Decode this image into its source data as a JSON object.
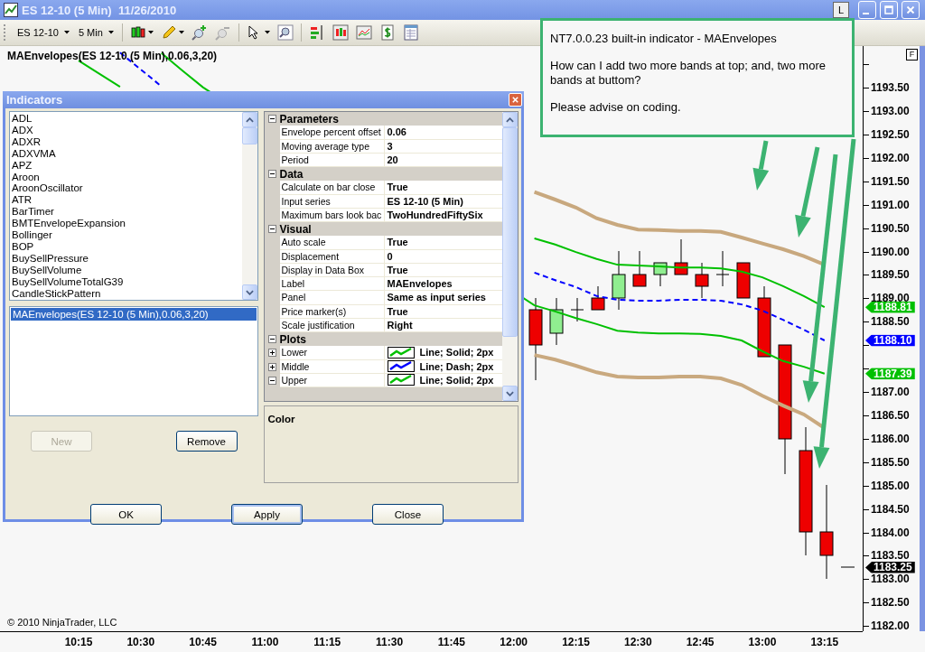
{
  "window": {
    "title": "ES 12-10 (5 Min)  11/26/2010",
    "extra_button": "L"
  },
  "toolbar": {
    "instrument": "ES 12-10",
    "interval": "5 Min"
  },
  "chart": {
    "label": "MAEnvelopes(ES 12-10 (5 Min),0.06,3,20)",
    "copyright": "© 2010 NinjaTrader, LLC",
    "scale_button": "F",
    "chart_data": {
      "type": "line",
      "xlim": [
        596.04,
        804.2
      ],
      "ylim": [
        1181.85,
        1194.39
      ],
      "x": [
        615,
        620,
        625,
        630,
        635,
        640,
        645,
        725,
        730,
        735,
        740,
        745,
        750,
        755,
        760,
        765,
        770,
        775,
        780,
        785,
        790,
        795
      ],
      "series": [
        {
          "color": "#c8a87e",
          "values": [
            null,
            null,
            null,
            null,
            null,
            null,
            null,
            1191.27,
            1191.11,
            1190.94,
            1190.71,
            1190.57,
            1190.47,
            1190.46,
            1190.44,
            1190.44,
            1190.42,
            1190.3,
            1190.17,
            1190.05,
            1189.9,
            1189.72
          ]
        },
        {
          "color": "#c9a97f",
          "values": [
            null,
            null,
            null,
            null,
            null,
            null,
            null,
            1187.79,
            1187.69,
            1187.56,
            1187.42,
            1187.33,
            1187.31,
            1187.31,
            1187.33,
            1187.33,
            1187.29,
            1187.15,
            1186.92,
            1186.71,
            1186.52,
            1186.23
          ]
        },
        {
          "color": "#00c000",
          "values": [
            1194.08,
            1193.8,
            1193.52,
            null,
            null,
            null,
            null,
            1190.28,
            1190.15,
            1189.99,
            1189.84,
            1189.72,
            1189.7,
            1189.68,
            1189.66,
            1189.66,
            1189.64,
            1189.57,
            1189.45,
            1189.26,
            1189.05,
            1188.81
          ]
        },
        {
          "color": "#0000ff",
          "line_style": "dashed",
          "values": [
            null,
            null,
            1194.25,
            1193.89,
            1193.53,
            null,
            null,
            1189.55,
            1189.39,
            1189.24,
            1189.05,
            1188.97,
            1188.95,
            1188.95,
            1188.97,
            1188.97,
            1188.95,
            1188.87,
            1188.74,
            1188.54,
            1188.33,
            1188.1
          ]
        },
        {
          "color": "#00c001",
          "values": [
            null,
            null,
            null,
            null,
            1194.24,
            1193.87,
            1193.51,
            1188.85,
            1188.72,
            1188.58,
            1188.45,
            1188.31,
            1188.27,
            1188.25,
            1188.25,
            1188.24,
            1188.2,
            1188.1,
            1187.87,
            1187.66,
            1187.54,
            1187.39
          ]
        }
      ],
      "yticks": [
        {
          "value": 1182,
          "label": "1182.00"
        },
        {
          "value": 1182.5,
          "label": "1182.50"
        },
        {
          "value": 1183,
          "label": "1183.00"
        },
        {
          "value": 1183.5,
          "label": "1183.50"
        },
        {
          "value": 1184,
          "label": "1184.00"
        },
        {
          "value": 1184.5,
          "label": "1184.50"
        },
        {
          "value": 1185,
          "label": "1185.00"
        },
        {
          "value": 1185.5,
          "label": "1185.50"
        },
        {
          "value": 1186,
          "label": "1186.00"
        },
        {
          "value": 1186.5,
          "label": "1186.50"
        },
        {
          "value": 1187,
          "label": "1187.00"
        },
        {
          "value": 1188.5,
          "label": "1188.50"
        },
        {
          "value": 1189,
          "label": "1189.00"
        },
        {
          "value": 1189.5,
          "label": "1189.50"
        },
        {
          "value": 1190,
          "label": "1190.00"
        },
        {
          "value": 1190.5,
          "label": "1190.50"
        },
        {
          "value": 1191,
          "label": "1191.00"
        },
        {
          "value": 1191.5,
          "label": "1191.50"
        },
        {
          "value": 1192,
          "label": "1192.00"
        },
        {
          "value": 1192.5,
          "label": "1192.50"
        },
        {
          "value": 1193,
          "label": "1193.00"
        },
        {
          "value": 1193.5,
          "label": "1193.50"
        }
      ],
      "xticks": [
        {
          "value": 615,
          "label": "10:15"
        },
        {
          "value": 630,
          "label": "10:30"
        },
        {
          "value": 645,
          "label": "10:45"
        },
        {
          "value": 660,
          "label": "11:00"
        },
        {
          "value": 675,
          "label": "11:15"
        },
        {
          "value": 690,
          "label": "11:30"
        },
        {
          "value": 705,
          "label": "11:45"
        },
        {
          "value": 720,
          "label": "12:00"
        },
        {
          "value": 735,
          "label": "12:15"
        },
        {
          "value": 750,
          "label": "12:30"
        },
        {
          "value": 765,
          "label": "12:45"
        },
        {
          "value": 780,
          "label": "13:00"
        },
        {
          "value": 795,
          "label": "13:15"
        }
      ]
    },
    "price_markers": [
      {
        "text": "1188.81",
        "color": "#00c000"
      },
      {
        "text": "1188.10",
        "color": "#0000ff"
      },
      {
        "text": "1187.39",
        "color": "#00c000"
      },
      {
        "text": "1183.25",
        "color": "#000000"
      }
    ]
  },
  "annotation": {
    "paragraphs": [
      "NT7.0.0.23 built-in indicator - MAEnvelopes",
      "How can I add two more bands at top; and, two more bands at buttom?",
      "Please advise on coding."
    ]
  },
  "dialog": {
    "title": "Indicators",
    "available": [
      {
        "label": "ADL",
        "selected": false
      },
      {
        "label": "ADX",
        "selected": false
      },
      {
        "label": "ADXR",
        "selected": false
      },
      {
        "label": "ADXVMA",
        "selected": false
      },
      {
        "label": "APZ",
        "selected": false
      },
      {
        "label": "Aroon",
        "selected": false
      },
      {
        "label": "AroonOscillator",
        "selected": false
      },
      {
        "label": "ATR",
        "selected": false
      },
      {
        "label": "BarTimer",
        "selected": false
      },
      {
        "label": "BMTEnvelopeExpansion",
        "selected": false
      },
      {
        "label": "Bollinger",
        "selected": false
      },
      {
        "label": "BOP",
        "selected": false
      },
      {
        "label": "BuySellPressure",
        "selected": false
      },
      {
        "label": "BuySellVolume",
        "selected": false
      },
      {
        "label": "BuySellVolumeTotalG39",
        "selected": false
      },
      {
        "label": "CandleStickPattern",
        "selected": false
      }
    ],
    "configured": [
      {
        "label": "MAEnvelopes(ES 12-10 (5 Min),0.06,3,20)",
        "selected": true
      }
    ],
    "list_buttons": [
      {
        "label": "New",
        "disabled": true
      },
      {
        "label": "Remove",
        "disabled": false
      }
    ],
    "properties": [
      {
        "category": "Parameters",
        "expanded": true,
        "rows": [
          {
            "name": "Envelope percent offset",
            "value": "0.06"
          },
          {
            "name": "Moving average type",
            "value": "3"
          },
          {
            "name": "Period",
            "value": "20"
          }
        ]
      },
      {
        "category": "Data",
        "expanded": true,
        "rows": [
          {
            "name": "Calculate on bar close",
            "value": "True"
          },
          {
            "name": "Input series",
            "value": "ES 12-10 (5 Min)"
          },
          {
            "name": "Maximum bars look bac",
            "value": "TwoHundredFiftySix"
          }
        ]
      },
      {
        "category": "Visual",
        "expanded": true,
        "rows": [
          {
            "name": "Auto scale",
            "value": "True"
          },
          {
            "name": "Displacement",
            "value": "0"
          },
          {
            "name": "Display in Data Box",
            "value": "True"
          },
          {
            "name": "Label",
            "value": "MAEnvelopes"
          },
          {
            "name": "Panel",
            "value": "Same as input series"
          },
          {
            "name": "Price marker(s)",
            "value": "True"
          },
          {
            "name": "Scale justification",
            "value": "Right"
          }
        ]
      },
      {
        "category": "Plots",
        "expanded": true,
        "rows": [
          {
            "name": "Lower",
            "value": "Line; Solid; 2px",
            "expanded": false,
            "color": "#00c000"
          },
          {
            "name": "Middle",
            "value": "Line; Dash; 2px",
            "expanded": false,
            "color": "#0000ff"
          },
          {
            "name": "Upper",
            "value": "Line; Solid; 2px",
            "expanded": true,
            "color": "#00c000"
          }
        ]
      }
    ],
    "description": {
      "title": "Color"
    },
    "buttons": [
      {
        "label": "OK",
        "default": false
      },
      {
        "label": "Apply",
        "default": true
      },
      {
        "label": "Close",
        "default": false
      }
    ]
  }
}
